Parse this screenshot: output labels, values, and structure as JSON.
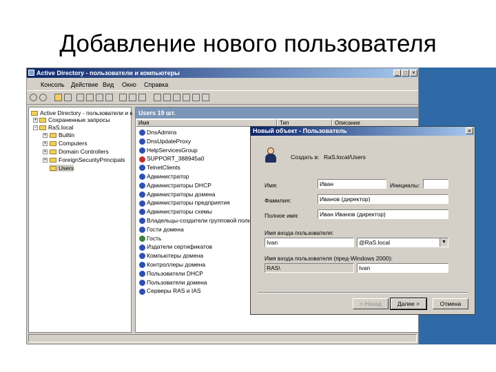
{
  "slide": {
    "title": "Добавление нового пользователя"
  },
  "window": {
    "title": "Active Directory - пользователи и компьютеры",
    "menu": [
      "Консоль",
      "Действие",
      "Вид",
      "Окно",
      "Справка"
    ]
  },
  "tree": {
    "root": "Active Directory - пользователи и к",
    "items": [
      "Сохраненные запросы",
      "RaS.local",
      "Builtin",
      "Computers",
      "Domain Controllers",
      "ForeignSecurityPrincipals",
      "Users"
    ]
  },
  "list": {
    "header": "Users   19 шт.",
    "columns": [
      "Имя",
      "Тип",
      "Описание"
    ],
    "rows": [
      "DnsAdmins",
      "DnsUpdateProxy",
      "HelpServicesGroup",
      "SUPPORT_388945a0",
      "TelnetClients",
      "Администратор",
      "Администраторы DHCP",
      "Администраторы домена",
      "Администраторы предприятия",
      "Администраторы схемы",
      "Владельцы-создатели групповой полит",
      "Гости домена",
      "Гость",
      "Издатели сертификатов",
      "Компьютеры домена",
      "Контроллеры домена",
      "Пользователи DHCP",
      "Пользователи домена",
      "Серверы RAS и IAS"
    ]
  },
  "dialog": {
    "title": "Новый объект - Пользователь",
    "create_in_label": "Создать в:",
    "create_in_value": "RaS.local/Users",
    "first_name_label": "Имя:",
    "first_name_value": "Иван",
    "initials_label": "Инициалы:",
    "initials_value": "",
    "last_name_label": "Фамилия:",
    "last_name_value": "Иванов (директор)",
    "full_name_label": "Полное имя:",
    "full_name_value": "Иван Иванов (директор)",
    "logon_name_label": "Имя входа пользователя:",
    "logon_name_value": "Ivan",
    "domain_suffix": "@RaS.local",
    "prewin2000_label": "Имя входа пользователя (пред-Windows 2000):",
    "prewin2000_domain": "RAS\\",
    "prewin2000_value": "Ivan",
    "back_button": "< Назад",
    "next_button": "Далее >",
    "cancel_button": "Отмена"
  }
}
